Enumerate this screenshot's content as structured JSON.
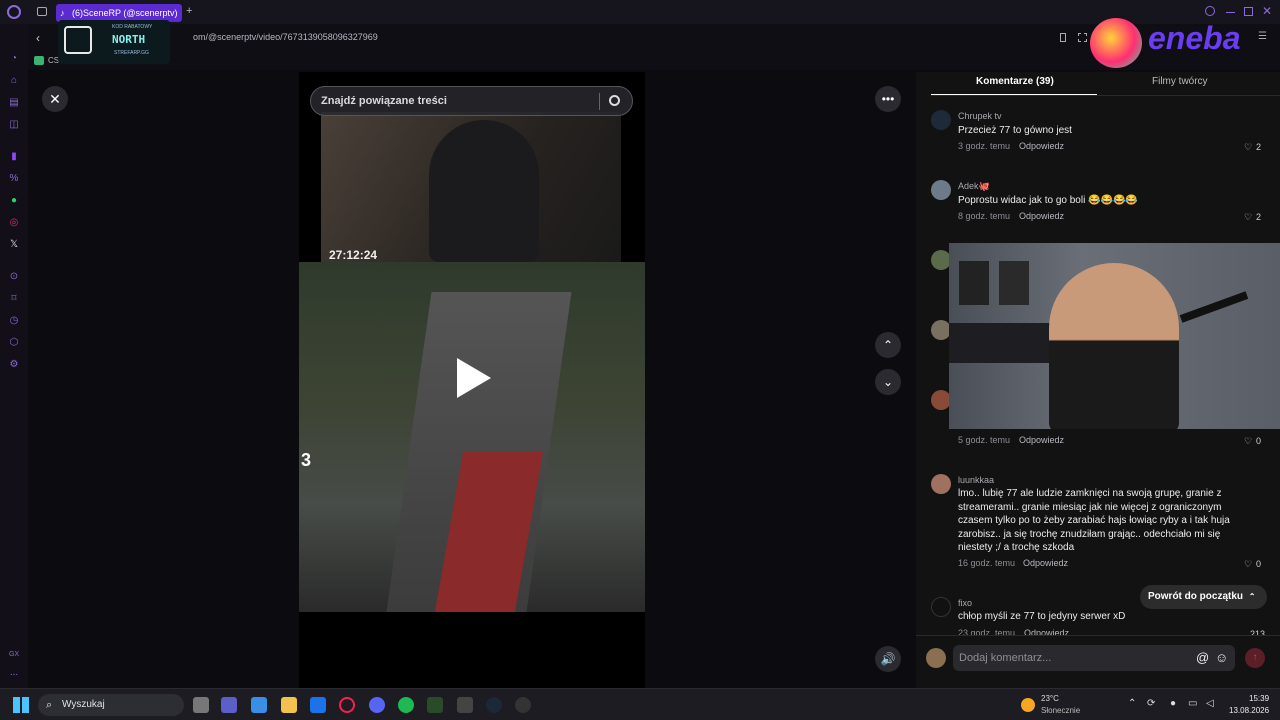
{
  "browser": {
    "tab_title": "(6)SceneRP (@scenerptv)",
    "new_tab": "+",
    "url": "om/@scenerptv/video/7673139058096327969",
    "bookmark_1": "CSGOSKINS"
  },
  "promo": {
    "line1": "KOD RABATOWY",
    "brand": "NORTH",
    "line3": "STREFARP.GG"
  },
  "ad": {
    "brand": "eneba"
  },
  "player": {
    "search_placeholder": "Znajdź powiązane treści",
    "overlay_timer": "27:12:24",
    "side_number": "3"
  },
  "comments_panel": {
    "tab_comments": "Komentarze (39)",
    "tab_creator": "Filmy twórcy",
    "reply_label": "Odpowiedz",
    "back_to_top": "Powrót do początku",
    "add_comment_placeholder": "Dodaj komentarz...",
    "mention": "@",
    "items": [
      {
        "user": "Chrupek tv",
        "text": "Przecież 77 to gówno jest",
        "time": "3 godz. temu",
        "likes": "2"
      },
      {
        "user": "Adek🐙",
        "text": "Poprostu widac jak to go boli 😂😂😂😂",
        "time": "8 godz. temu",
        "likes": "2"
      },
      {
        "user": "",
        "text": "",
        "time": "5 godz. temu",
        "likes": "0"
      },
      {
        "user": "luunkkaa",
        "text": "lmo.. lubię 77 ale ludzie zamknięci na swoją grupę, granie z streamerami.. granie miesiąc jak nie więcej z ograniczonym czasem tylko po to żeby zarabiać hajs łowiąc ryby a i tak huja zarobisz.. ja się trochę znudziłam grając.. odechciało mi się niestety ;/ a trochę szkoda",
        "time": "16 godz. temu",
        "likes": "0"
      },
      {
        "user": "fixo",
        "text": "chłop myśli ze 77 to jedyny serwer xD",
        "time": "23 godz. temu",
        "likes": "213"
      }
    ]
  },
  "taskbar": {
    "search": "Wyszukaj",
    "weather_temp": "23°C",
    "weather_desc": "Słonecznie",
    "time": "15:39",
    "date": "13.08.2026"
  },
  "sidebar": {
    "gx_label": "GX",
    "more_label": "..."
  },
  "colors": {
    "accent": "#5b2bd1",
    "tiktok_red": "#fe2c55",
    "eneba_purple": "#6a3df0"
  }
}
